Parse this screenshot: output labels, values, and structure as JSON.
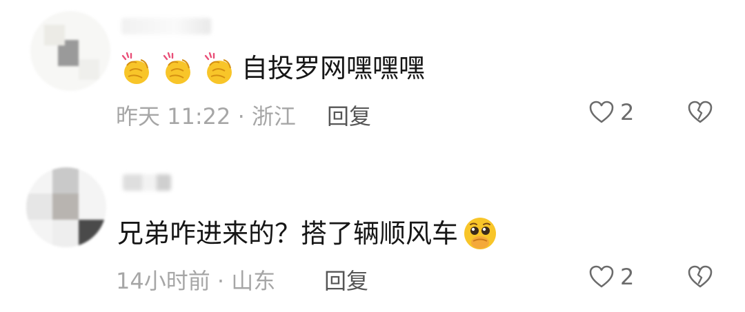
{
  "comments": [
    {
      "text": "自投罗网嘿嘿嘿",
      "leading_emojis": [
        "clapping-hands-icon",
        "clapping-hands-icon",
        "clapping-hands-icon"
      ],
      "meta": "昨天 11:22 · 浙江",
      "reply_label": "回复",
      "like_count": "2"
    },
    {
      "text": "兄弟咋进来的？搭了辆顺风车",
      "trailing_emoji": "pleading-face-icon",
      "meta": "14小时前 · 山东",
      "reply_label": "回复",
      "like_count": "2"
    }
  ],
  "colors": {
    "text": "#161616",
    "meta": "#a6a6a6",
    "reply": "#555555",
    "icon": "#6b6b6b",
    "emoji_yellow": "#f8c529"
  }
}
